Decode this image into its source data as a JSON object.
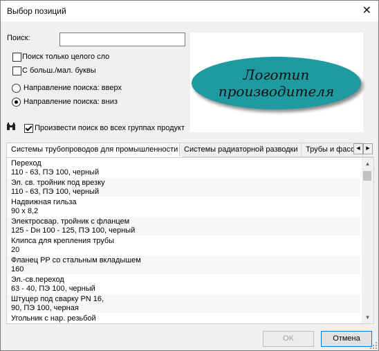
{
  "window": {
    "title": "Выбор позиций",
    "close_glyph": "✕"
  },
  "search": {
    "label": "Поиск:",
    "value": ""
  },
  "options": {
    "whole_word": {
      "label": "Поиск только целого сло",
      "checked": false
    },
    "match_case": {
      "label": "С больш./мал. буквы",
      "checked": false
    },
    "dir_up": {
      "label": "Направление поиска: вверх",
      "selected": false
    },
    "dir_down": {
      "label": "Направление поиска: вниз",
      "selected": true
    },
    "all_groups": {
      "label": "Произвести поиск во всех группах продукт",
      "checked": true
    }
  },
  "logo": {
    "line1": "Логотип",
    "line2": "производителя",
    "color": "#1f9aa0"
  },
  "tabs": [
    {
      "label": "Системы трубопроводов для промышленности"
    },
    {
      "label": "Системы радиаторной разводки"
    },
    {
      "label": "Трубы и фасо"
    }
  ],
  "items": [
    {
      "line1": "Переход",
      "line2": "110 - 63, ПЭ 100, черный"
    },
    {
      "line1": "Эл. св. тройник под врезку",
      "line2": "110 - 63, ПЭ 100, черный"
    },
    {
      "line1": "Надвижная гильза",
      "line2": "90 х 8,2"
    },
    {
      "line1": "Электросвар. тройник с фланцем",
      "line2": "125 - Dн 100 - 125, ПЭ 100, черный"
    },
    {
      "line1": "Клипса для крепления трубы",
      "line2": "20"
    },
    {
      "line1": "Фланец PP со стальным вкладышем",
      "line2": "160"
    },
    {
      "line1": "Эл.-св.переход",
      "line2": "63 - 40, ПЭ 100, черный"
    },
    {
      "line1": "Штуцер под сварку PN 16,",
      "line2": "90, ПЭ 100, черная"
    },
    {
      "line1": "Угольник с нар. резьбой",
      "line2": ""
    }
  ],
  "buttons": {
    "ok": "OK",
    "cancel": "Отмена"
  }
}
